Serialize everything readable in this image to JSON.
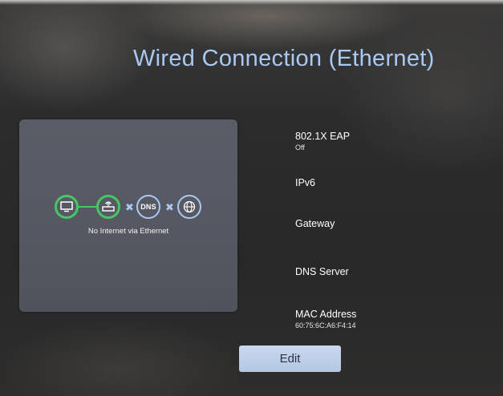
{
  "title": "Wired Connection (Ethernet)",
  "colors": {
    "accent_blue": "#a9c9f3",
    "connected_green": "#45c762",
    "panel": "#565963",
    "button": "#bccde6"
  },
  "diagram": {
    "nodes": [
      {
        "icon": "tv-icon",
        "state": "connected"
      },
      {
        "icon": "router-icon",
        "state": "connected"
      },
      {
        "icon": "dns-icon",
        "label": "DNS",
        "state": "disconnected"
      },
      {
        "icon": "globe-icon",
        "state": "disconnected"
      }
    ],
    "status": "No Internet via Ethernet"
  },
  "settings": {
    "eap": {
      "label": "802.1X EAP",
      "value": "Off"
    },
    "ipv6": {
      "label": "IPv6"
    },
    "gateway": {
      "label": "Gateway"
    },
    "dns_server": {
      "label": "DNS Server"
    },
    "mac_address": {
      "label": "MAC Address",
      "value": "60:75:6C:A6:F4:14"
    }
  },
  "edit_button": {
    "label": "Edit"
  }
}
